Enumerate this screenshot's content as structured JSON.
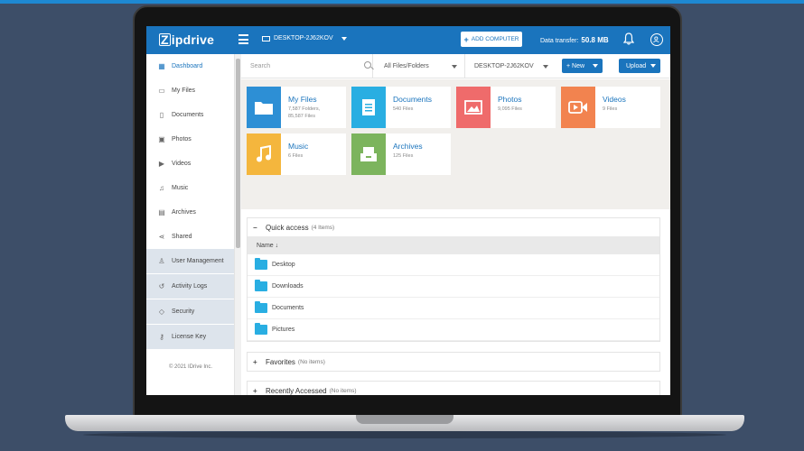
{
  "app": {
    "logo_z": "Z",
    "logo_rest": "ipdrive",
    "computer_name": "DESKTOP-2J62KOV",
    "add_computer_label": "ADD COMPUTER",
    "data_transfer_label": "Data transfer:",
    "data_transfer_value": "50.8 MB"
  },
  "sidebar": {
    "items": [
      {
        "label": "Dashboard",
        "icon": "dashboard-icon",
        "glyph": "▦"
      },
      {
        "label": "My Files",
        "icon": "files-icon",
        "glyph": "▭"
      },
      {
        "label": "Documents",
        "icon": "document-icon",
        "glyph": "▯"
      },
      {
        "label": "Photos",
        "icon": "photo-icon",
        "glyph": "▣"
      },
      {
        "label": "Videos",
        "icon": "video-icon",
        "glyph": "▶"
      },
      {
        "label": "Music",
        "icon": "music-icon",
        "glyph": "♫"
      },
      {
        "label": "Archives",
        "icon": "archive-icon",
        "glyph": "▤"
      },
      {
        "label": "Shared",
        "icon": "share-icon",
        "glyph": "⋖"
      }
    ],
    "admin_items": [
      {
        "label": "User Management",
        "icon": "user-management-icon",
        "glyph": "♙"
      },
      {
        "label": "Activity Logs",
        "icon": "history-icon",
        "glyph": "↺"
      },
      {
        "label": "Security",
        "icon": "shield-icon",
        "glyph": "◇"
      },
      {
        "label": "License Key",
        "icon": "key-icon",
        "glyph": "⚷"
      }
    ],
    "copyright": "© 2021 IDrive Inc."
  },
  "toolbar": {
    "search_placeholder": "Search",
    "filter_value": "All Files/Folders",
    "computer_value": "DESKTOP-2J62KOV",
    "new_label": "+ New",
    "upload_label": "Upload"
  },
  "categories": [
    {
      "title": "My Files",
      "sub": "7,587 Folders,\n85,587 Files",
      "color": "#2d8fd5",
      "icon": "folder-icon"
    },
    {
      "title": "Documents",
      "sub": "540 Files",
      "color": "#29aee2",
      "icon": "document-icon"
    },
    {
      "title": "Photos",
      "sub": "9,095 Files",
      "color": "#ef6b6b",
      "icon": "photo-icon"
    },
    {
      "title": "Videos",
      "sub": "9 Files",
      "color": "#f2834f",
      "icon": "video-icon"
    },
    {
      "title": "Music",
      "sub": "6 Files",
      "color": "#f4b63d",
      "icon": "music-icon"
    },
    {
      "title": "Archives",
      "sub": "125 Files",
      "color": "#7cb45d",
      "icon": "archive-icon"
    }
  ],
  "quick_access": {
    "sign": "−",
    "title": "Quick access",
    "count": "(4 Items)",
    "column_name": "Name ↓",
    "rows": [
      "Desktop",
      "Downloads",
      "Documents",
      "Pictures"
    ]
  },
  "favorites": {
    "sign": "+",
    "title": "Favorites",
    "count": "(No items)"
  },
  "recent": {
    "sign": "+",
    "title": "Recently Accessed",
    "count": "(No items)"
  }
}
